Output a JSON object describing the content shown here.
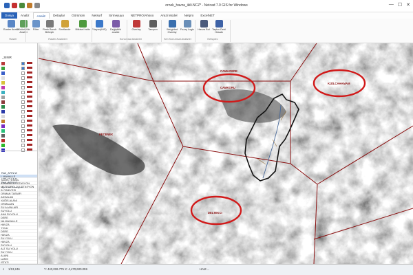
{
  "window": {
    "title": "ornek_havza_ikili.NCZ* - Netcad 7.0 GIS for Windows",
    "controls": {
      "minimize": "—",
      "maximize": "☐",
      "close": "✕"
    }
  },
  "ribbon_tabs": [
    "Dosya",
    "Analiz",
    "Analiz",
    "Detaylar",
    "Görünüm",
    "Netsurf",
    "Sirmeyuyu",
    "NETPRO/Ahsoo",
    "Arazi Model",
    "Netpro",
    "ExcelNET"
  ],
  "ribbon_buttons": [
    {
      "label": "Ruster Analiz",
      "color": "#5b87c6"
    },
    {
      "label": "Görünürlük Analizi",
      "color": "#5fa05a"
    },
    {
      "label": "Filtre",
      "color": "#6b94c9"
    },
    {
      "label": "Renk Bandı Birleştir",
      "color": "#7a7a7a"
    },
    {
      "label": "Sınıflandır",
      "color": "#d0a23a"
    },
    {
      "label": "Bitkisel İndis",
      "color": "#4e9a3e"
    },
    {
      "label": "Füzyon(IHS)",
      "color": "#3b78c9"
    },
    {
      "label": "Değişiklik analizi",
      "color": "#7b5ca8"
    },
    {
      "label": "Overlay",
      "color": "#c03a3a"
    },
    {
      "label": "Tampon",
      "color": "#5f5f5f"
    },
    {
      "label": "Weighted Overlay",
      "color": "#3a6fae"
    },
    {
      "label": "Fuzzy Logic",
      "color": "#6a8fb8"
    },
    {
      "label": "Havza Bul",
      "color": "#4a5a7c"
    },
    {
      "label": "Taşkın Debi Hesabı",
      "color": "#3e62a6"
    }
  ],
  "ribbon_groups": [
    "Raster",
    "Raster Analizleri",
    "Konumsal Analizler",
    "Sen Konumsal Analizler",
    "Netsydro"
  ],
  "layers_panel": {
    "layer_name": "_SINIR",
    "swatches": [
      "#b83a3a",
      "#3aa23a",
      "#3a5fc8",
      "#e0e0e0",
      "#d8c23a",
      "#c03ab0",
      "#3ab0c0",
      "#a0a0a0",
      "#8a3a3a",
      "#2a8a4a",
      "#2a3aa8",
      "#d9d9d9",
      "#c07a2a",
      "#7a2ac0",
      "#2ac07a",
      "#606060",
      "#b82a2a",
      "#2ab82a",
      "#2a2ab8"
    ],
    "checked": [
      true,
      true,
      false,
      false,
      false,
      false,
      false,
      false,
      false,
      false,
      false,
      false,
      false,
      false,
      false,
      false,
      false,
      false,
      false
    ]
  },
  "mid_labels": [
    "Ra2_AFIN.W",
    "Ra3_AFIN.W",
    "Ra4_AFIN.W",
    "ajn Katlı Fonsiyon"
  ],
  "list_items": [
    "I. MAHALLE",
    "YAĞIŞ TEMSIL",
    "KOORDILGI İSTASYON",
    "METEOROLOJI İSTASYON",
    "IN TABIYESI",
    "ORMAN TASNIFI",
    "ADSALAN",
    "YAĞIŞ ALANI",
    "ORMALAN",
    "SU ALANLARI",
    "SUYOLU",
    "ANA SUYOLU",
    "DERE",
    "NA MAHALLE",
    "HAVZA",
    "YOLU",
    "DERE",
    "HAVZA",
    "SU YOLU",
    "HAVZA",
    "SUYOLU",
    "ALT SU YOLU",
    "SU YOLU",
    "ALANI",
    "LAKM",
    "ISTATI"
  ],
  "map_labels": {
    "camkoru_top": "CAMLIDERE",
    "camkoru": "CAMKORU",
    "kizilcahamam": "KIZILCAHAMAM",
    "pecenek": "PECENEK",
    "deltekci": "DELTEKCI"
  },
  "status": {
    "scale": "1/13,246",
    "coordinates": "Y: 443,026.775  X: 4,470,600.059",
    "mode": "HAM ..."
  },
  "colors": {
    "accent": "#2a63b8",
    "annotation_red": "#d11a1a",
    "boundary_red": "#8a1010",
    "watershed": "#111111"
  }
}
